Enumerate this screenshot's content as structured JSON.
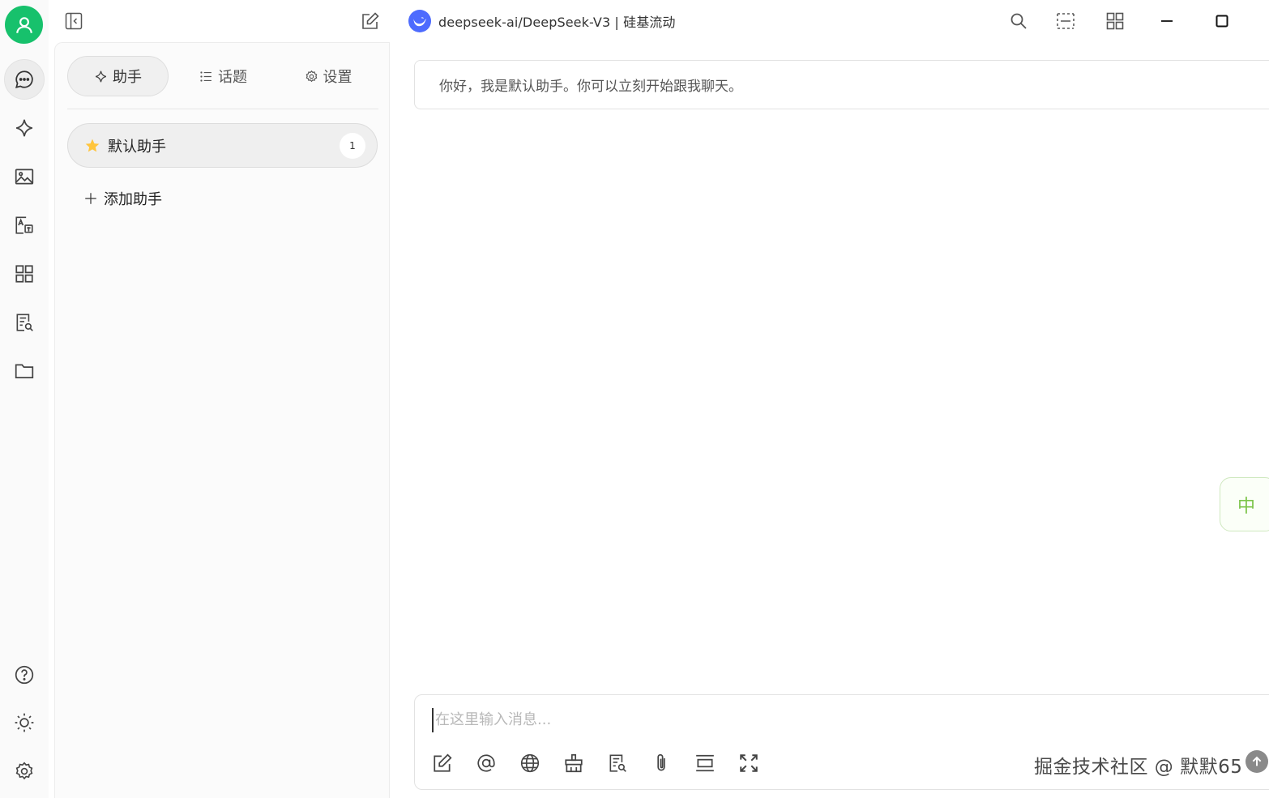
{
  "titlebar": {
    "model_name": "deepseek-ai/DeepSeek-V3 | 硅基流动",
    "icons": [
      "sidebar-toggle-icon",
      "new-chat-icon",
      "search-icon",
      "layout-icon",
      "grid-icon",
      "minimize-icon",
      "maximize-icon"
    ]
  },
  "rail": {
    "items": [
      "chat-icon",
      "sparkle-icon",
      "image-icon",
      "translate-icon",
      "apps-icon",
      "document-search-icon",
      "folder-icon"
    ],
    "bottom": [
      "help-icon",
      "theme-icon",
      "settings-icon"
    ],
    "accent": "#17c16c"
  },
  "tabs": [
    {
      "label": "助手",
      "icon": "sparkle-icon"
    },
    {
      "label": "话题",
      "icon": "list-icon"
    },
    {
      "label": "设置",
      "icon": "gear-icon"
    }
  ],
  "assistants": [
    {
      "name": "默认助手",
      "icon": "star-icon",
      "count": "1"
    }
  ],
  "add_assistant_label": "添加助手",
  "chat": {
    "greeting": "你好，我是默认助手。你可以立刻开始跟我聊天。",
    "float_label": "中",
    "input_placeholder": "在这里输入消息...",
    "tools": [
      "new-topic-icon",
      "mention-icon",
      "web-search-icon",
      "clear-icon",
      "knowledge-icon",
      "attachment-icon",
      "divider-icon",
      "expand-icon"
    ]
  },
  "watermark": "掘金技术社区 @ 默默65"
}
